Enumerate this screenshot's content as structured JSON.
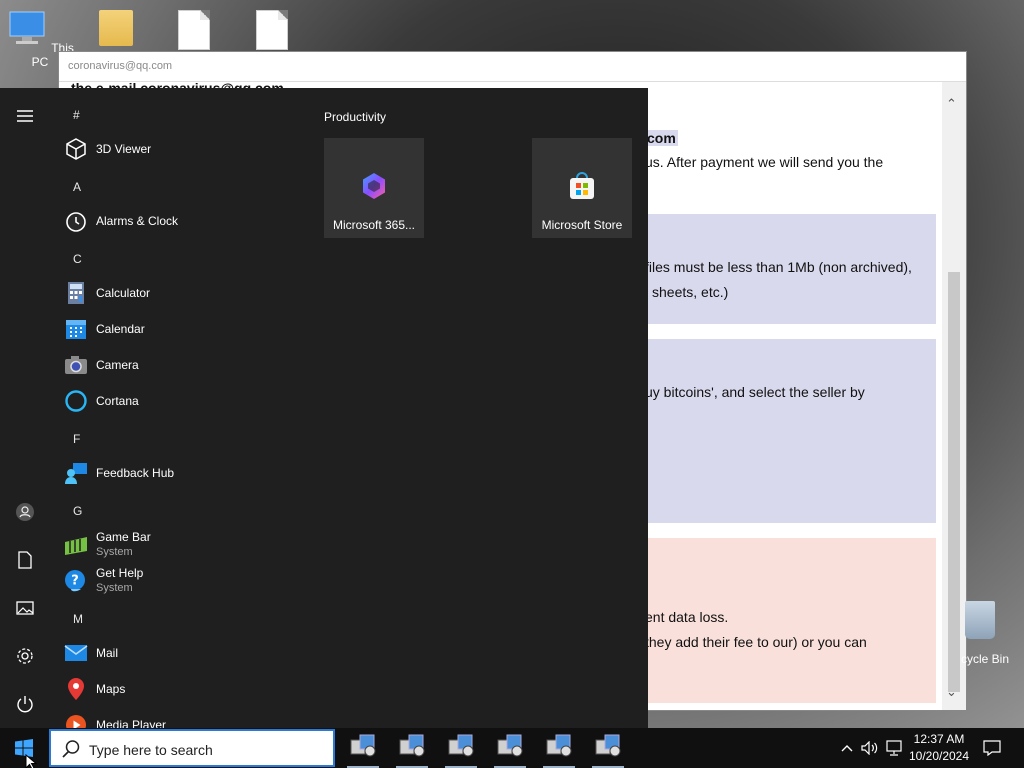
{
  "desktop": {
    "icons": [
      {
        "label": "This PC",
        "icon": "this-pc-icon"
      },
      {
        "label": "",
        "icon": "folder-icon"
      },
      {
        "label": "",
        "icon": "document-icon"
      },
      {
        "label": "",
        "icon": "document-icon"
      }
    ],
    "recycle_bin_label": "cycle Bin"
  },
  "note_window": {
    "title": "coronavirus@qq.com",
    "partial_heading": "the e-mail coronavirus@qq.com",
    "lines": [
      "com",
      "us. After payment we will send you the",
      "files must be less than 1Mb (non archived),",
      "l sheets, etc.)",
      "uy bitcoins', and select the seller by",
      "ent data loss.",
      "they add their fee to our) or you can"
    ]
  },
  "start_menu": {
    "sections": [
      {
        "letter": "#",
        "apps": [
          {
            "name": "3D Viewer",
            "icon": "3d-viewer-icon"
          }
        ]
      },
      {
        "letter": "A",
        "apps": [
          {
            "name": "Alarms & Clock",
            "icon": "alarm-clock-icon"
          }
        ]
      },
      {
        "letter": "C",
        "apps": [
          {
            "name": "Calculator",
            "icon": "calculator-icon"
          },
          {
            "name": "Calendar",
            "icon": "calendar-icon"
          },
          {
            "name": "Camera",
            "icon": "camera-icon"
          },
          {
            "name": "Cortana",
            "icon": "cortana-icon"
          }
        ]
      },
      {
        "letter": "F",
        "apps": [
          {
            "name": "Feedback Hub",
            "icon": "feedback-hub-icon"
          }
        ]
      },
      {
        "letter": "G",
        "apps": [
          {
            "name": "Game Bar",
            "sub": "System",
            "icon": "game-bar-icon"
          },
          {
            "name": "Get Help",
            "sub": "System",
            "icon": "get-help-icon"
          }
        ]
      },
      {
        "letter": "M",
        "apps": [
          {
            "name": "Mail",
            "icon": "mail-icon"
          },
          {
            "name": "Maps",
            "icon": "maps-icon"
          },
          {
            "name": "Media Player",
            "icon": "media-player-icon"
          }
        ]
      }
    ],
    "group_title": "Productivity",
    "tiles": [
      {
        "label": "Microsoft 365...",
        "icon": "microsoft-365-icon"
      },
      {
        "label": "Microsoft Store",
        "icon": "microsoft-store-icon"
      }
    ],
    "rail": [
      "hamburger-icon",
      "user-avatar-icon",
      "documents-icon",
      "pictures-icon",
      "settings-gear-icon",
      "power-icon"
    ]
  },
  "taskbar": {
    "search_placeholder": "Type here to search",
    "app_count": 6,
    "time": "12:37 AM",
    "date": "10/20/2024"
  }
}
